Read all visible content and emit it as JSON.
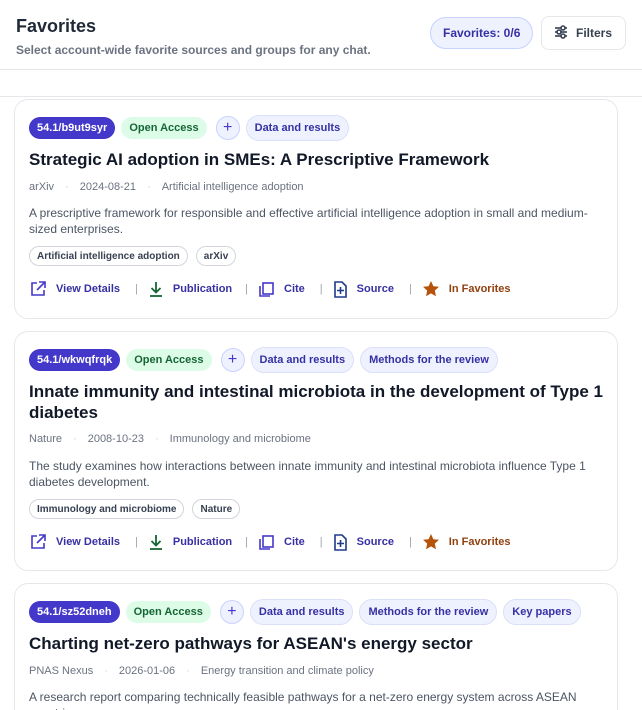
{
  "header": {
    "title": "Favorites",
    "subtitle": "Select account-wide favorite sources and groups for any chat.",
    "favorites_count": "Favorites: 0/6",
    "filters_label": "Filters"
  },
  "actions": {
    "view_details": "View Details",
    "publication": "Publication",
    "cite": "Cite",
    "source": "Source",
    "in_favorites": "In Favorites",
    "separator": "|"
  },
  "add_symbol": "+",
  "meta_separator": "·",
  "colors": {
    "accent": "#4338ca",
    "open_access_bg": "#dcfce7",
    "favorite": "#b45309"
  },
  "cards": [
    {
      "doi": "54.1/b9ut9syr",
      "access": "Open Access",
      "groups": [
        "Data and results"
      ],
      "title": "Strategic AI adoption in SMEs: A Prescriptive Framework",
      "source": "arXiv",
      "date": "2024-08-21",
      "topic": "Artificial intelligence adoption",
      "abstract": "A prescriptive framework for responsible and effective artificial intelligence adoption in small and medium-sized enterprises.",
      "chips": [
        "Artificial intelligence adoption",
        "arXiv"
      ]
    },
    {
      "doi": "54.1/wkwqfrqk",
      "access": "Open Access",
      "groups": [
        "Data and results",
        "Methods for the review"
      ],
      "title": "Innate immunity and intestinal microbiota in the development of Type 1 diabetes",
      "source": "Nature",
      "date": "2008-10-23",
      "topic": "Immunology and microbiome",
      "abstract": "The study examines how interactions between innate immunity and intestinal microbiota influence Type 1 diabetes development.",
      "chips": [
        "Immunology and microbiome",
        "Nature"
      ]
    },
    {
      "doi": "54.1/sz52dneh",
      "access": "Open Access",
      "groups": [
        "Data and results",
        "Methods for the review",
        "Key papers"
      ],
      "title": "Charting net-zero pathways for ASEAN's energy sector",
      "source": "PNAS Nexus",
      "date": "2026-01-06",
      "topic": "Energy transition and climate policy",
      "abstract": "A research report comparing technically feasible pathways for a net-zero energy system across ASEAN countries.",
      "chips": []
    }
  ]
}
